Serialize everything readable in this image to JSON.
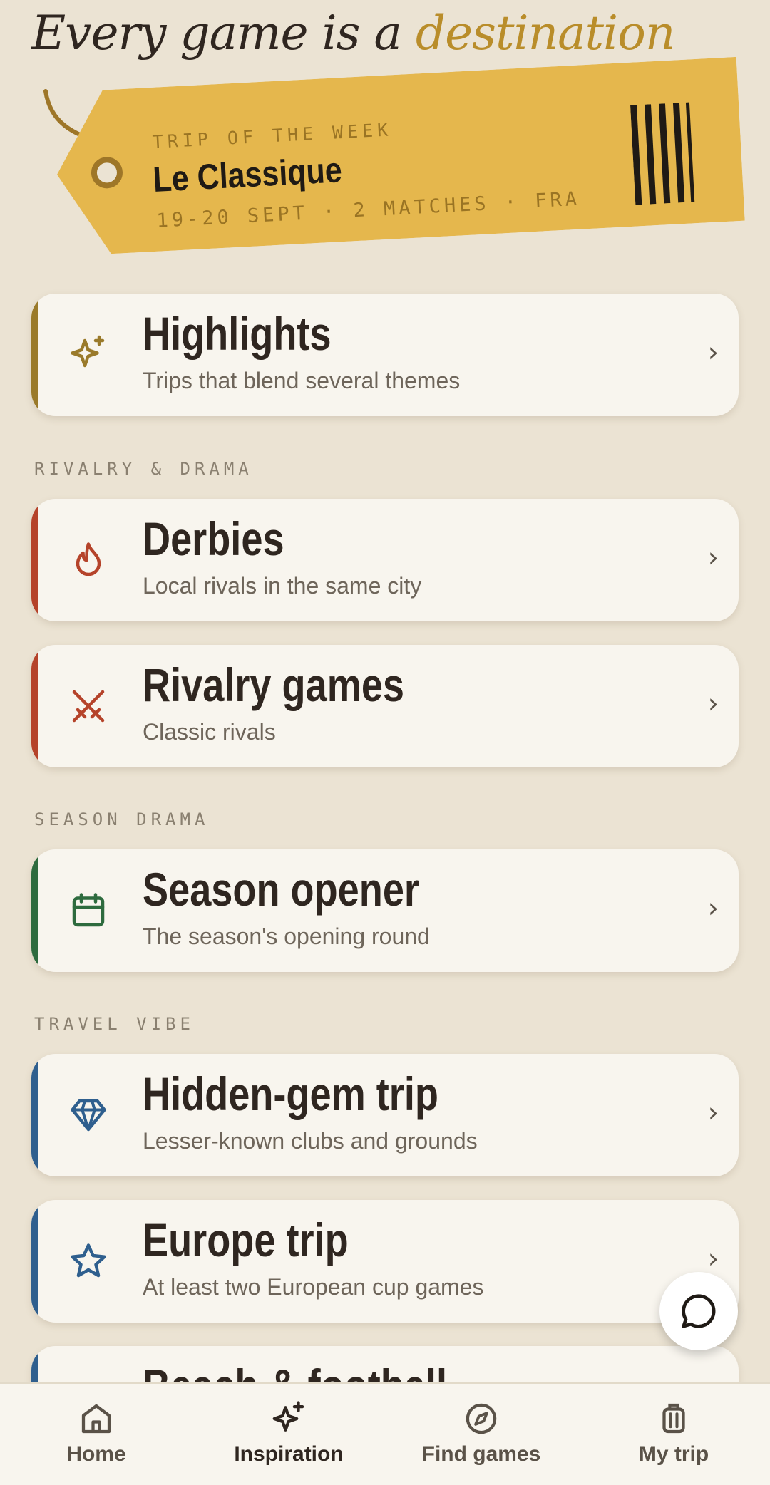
{
  "headline": {
    "prefix": "Every game is a",
    "accent": "destination"
  },
  "ticket": {
    "kicker": "TRIP OF THE WEEK",
    "title": "Le Classique",
    "meta": "19-20 SEPT · 2 MATCHES · FRA",
    "color": "#e5b74d"
  },
  "sections": {
    "rivalry": "RIVALRY & DRAMA",
    "season": "SEASON DRAMA",
    "travel": "TRAVEL VIBE"
  },
  "cards": {
    "highlights": {
      "title": "Highlights",
      "subtitle": "Trips that blend several themes",
      "icon": "sparkles-icon",
      "color": "#9a7a2a"
    },
    "derbies": {
      "title": "Derbies",
      "subtitle": "Local rivals in the same city",
      "icon": "flame-icon",
      "color": "#b5432a"
    },
    "rivalry_games": {
      "title": "Rivalry games",
      "subtitle": "Classic rivals",
      "icon": "crossed-swords-icon",
      "color": "#b5432a"
    },
    "season_opener": {
      "title": "Season opener",
      "subtitle": "The season's opening round",
      "icon": "calendar-icon",
      "color": "#2e6b3e"
    },
    "hidden_gem": {
      "title": "Hidden-gem trip",
      "subtitle": "Lesser-known clubs and grounds",
      "icon": "diamond-icon",
      "color": "#2f5f8e"
    },
    "europe_trip": {
      "title": "Europe trip",
      "subtitle": "At least two European cup games",
      "icon": "star-icon",
      "color": "#2f5f8e"
    },
    "beach_football": {
      "title": "Beach & football",
      "color": "#2f5f8e"
    }
  },
  "chevron": "›",
  "nav": {
    "home": "Home",
    "inspiration": "Inspiration",
    "find_games": "Find games",
    "my_trip": "My trip",
    "active": "inspiration"
  }
}
